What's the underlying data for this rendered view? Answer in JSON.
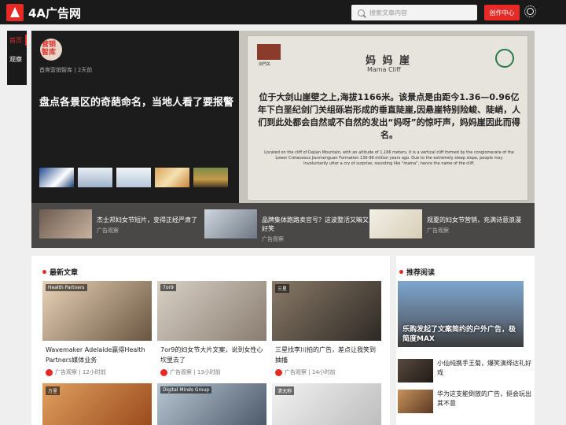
{
  "header": {
    "logo_text": "4A广告网",
    "search_placeholder": "搜索文章内容",
    "creator_button": "创作中心"
  },
  "sidenav": {
    "items": [
      {
        "label": "首页",
        "active": true
      },
      {
        "label": "观察",
        "active": false
      }
    ]
  },
  "hero": {
    "avatar_text": "营销智库",
    "author": "首席营销智库",
    "time": "2天前",
    "title": "盘点各景区的奇葩命名，当地人看了要报警",
    "image": {
      "sign_title": "妈 妈 崖",
      "sign_sub": "Mama Cliff",
      "sign_cn": "位于大剑山崖壁之上,海拔1166米。该景点是由距今1.36—0.96亿年下白垩纪剑门关组砾岩形成的垂直陡崖,因悬崖特别险峻、陡峭，人们到此处都会自然或不自然的发出“妈呀”的惊吁声，妈妈崖因此而得名。",
      "sign_en": "Located on the cliff of Dajian Mountain, with an altitude of 1,166 meters, it is a vertical cliff formed by the conglomerate of the Lower Cretaceous Jianmenguan Formation 136-96 million years ago. Due to the extremely steep slope, people may involuntarily utter a cry of surprise, sounding like \"mama\", hence the name of the cliff.",
      "sign_logo": "剑門关"
    }
  },
  "strip": [
    {
      "title": "杰士邦妇女节短片，变得正经严肃了",
      "category": "广告观察"
    },
    {
      "title": "品牌集体跑路卖官号？这波整活又嘛又好笑",
      "category": "广告观察"
    },
    {
      "title": "观夏的妇女节营销，充满诗意浪漫",
      "category": "广告观察"
    }
  ],
  "latest": {
    "heading": "最新文章",
    "cards": [
      {
        "tag": "Health Partners",
        "title": "Wavemaker Adelaide赢得Health Partners媒体业务",
        "category": "广告观察",
        "time": "12小时前",
        "color": "#8d7a5f"
      },
      {
        "tag": "7or9",
        "title": "7or9的妇女节大片文案，说到女性心坎里去了",
        "category": "广告观察",
        "time": "13小时前",
        "color": "#9a8e83"
      },
      {
        "tag": "三星",
        "title": "三星找李川拍的广告，差点让我笑到抽搐",
        "category": "广告观察",
        "time": "14小时前",
        "color": "#5c5148"
      }
    ],
    "cards_row2": [
      {
        "tag": "方里",
        "color": "#c0602a"
      },
      {
        "tag": "Digital Minds Group",
        "color": "#6e7b89"
      },
      {
        "tag": "清无称",
        "color": "#d8d8d8"
      }
    ]
  },
  "recommended": {
    "heading": "推荐阅读",
    "big_title": "乐购发起了文案简约的户外广告，极简度MAX",
    "items": [
      {
        "title": "小仙纯携手王菊，爆笑演绎达礼好戏",
        "color": "#3a2f2a"
      },
      {
        "title": "华为这支能倒放的广告，挺会玩出其不意",
        "color": "#7a5638"
      }
    ]
  }
}
